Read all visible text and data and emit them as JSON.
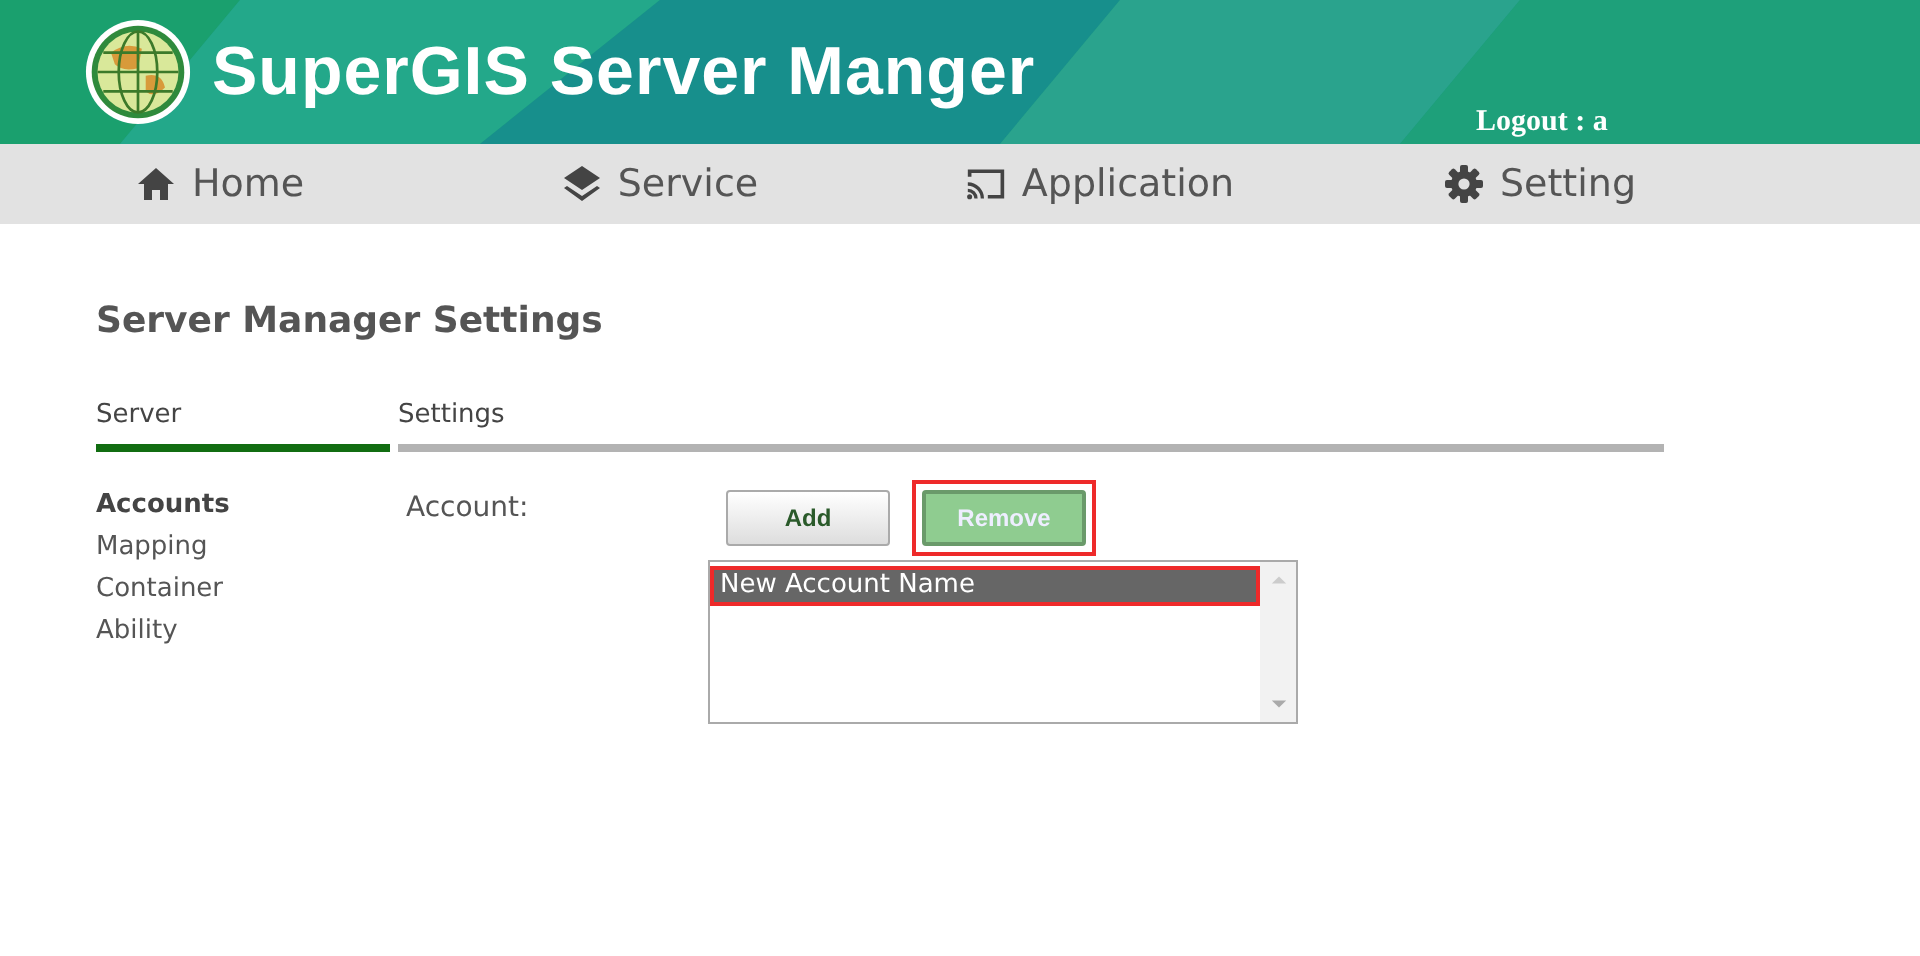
{
  "header": {
    "title": "SuperGIS Server Manger",
    "logout": "Logout : a"
  },
  "nav": [
    {
      "kind": "home",
      "label": "Home"
    },
    {
      "kind": "layers",
      "label": "Service"
    },
    {
      "kind": "cast",
      "label": "Application"
    },
    {
      "kind": "gear",
      "label": "Setting"
    }
  ],
  "page_title": "Server Manager Settings",
  "tabs": [
    {
      "label": "Server",
      "selected": true
    },
    {
      "label": "Settings",
      "selected": false
    }
  ],
  "sidebar": {
    "items": [
      {
        "label": "Accounts",
        "selected": true
      },
      {
        "label": "Mapping",
        "selected": false
      },
      {
        "label": "Container",
        "selected": false
      },
      {
        "label": "Ability",
        "selected": false
      }
    ]
  },
  "account": {
    "label": "Account:",
    "buttons": [
      {
        "label": "Add",
        "pressed": false,
        "highlighted": false
      },
      {
        "label": "Remove",
        "pressed": true,
        "highlighted": true
      }
    ],
    "list": [
      {
        "label": "New Account Name",
        "selected": true,
        "highlighted": true
      }
    ]
  }
}
